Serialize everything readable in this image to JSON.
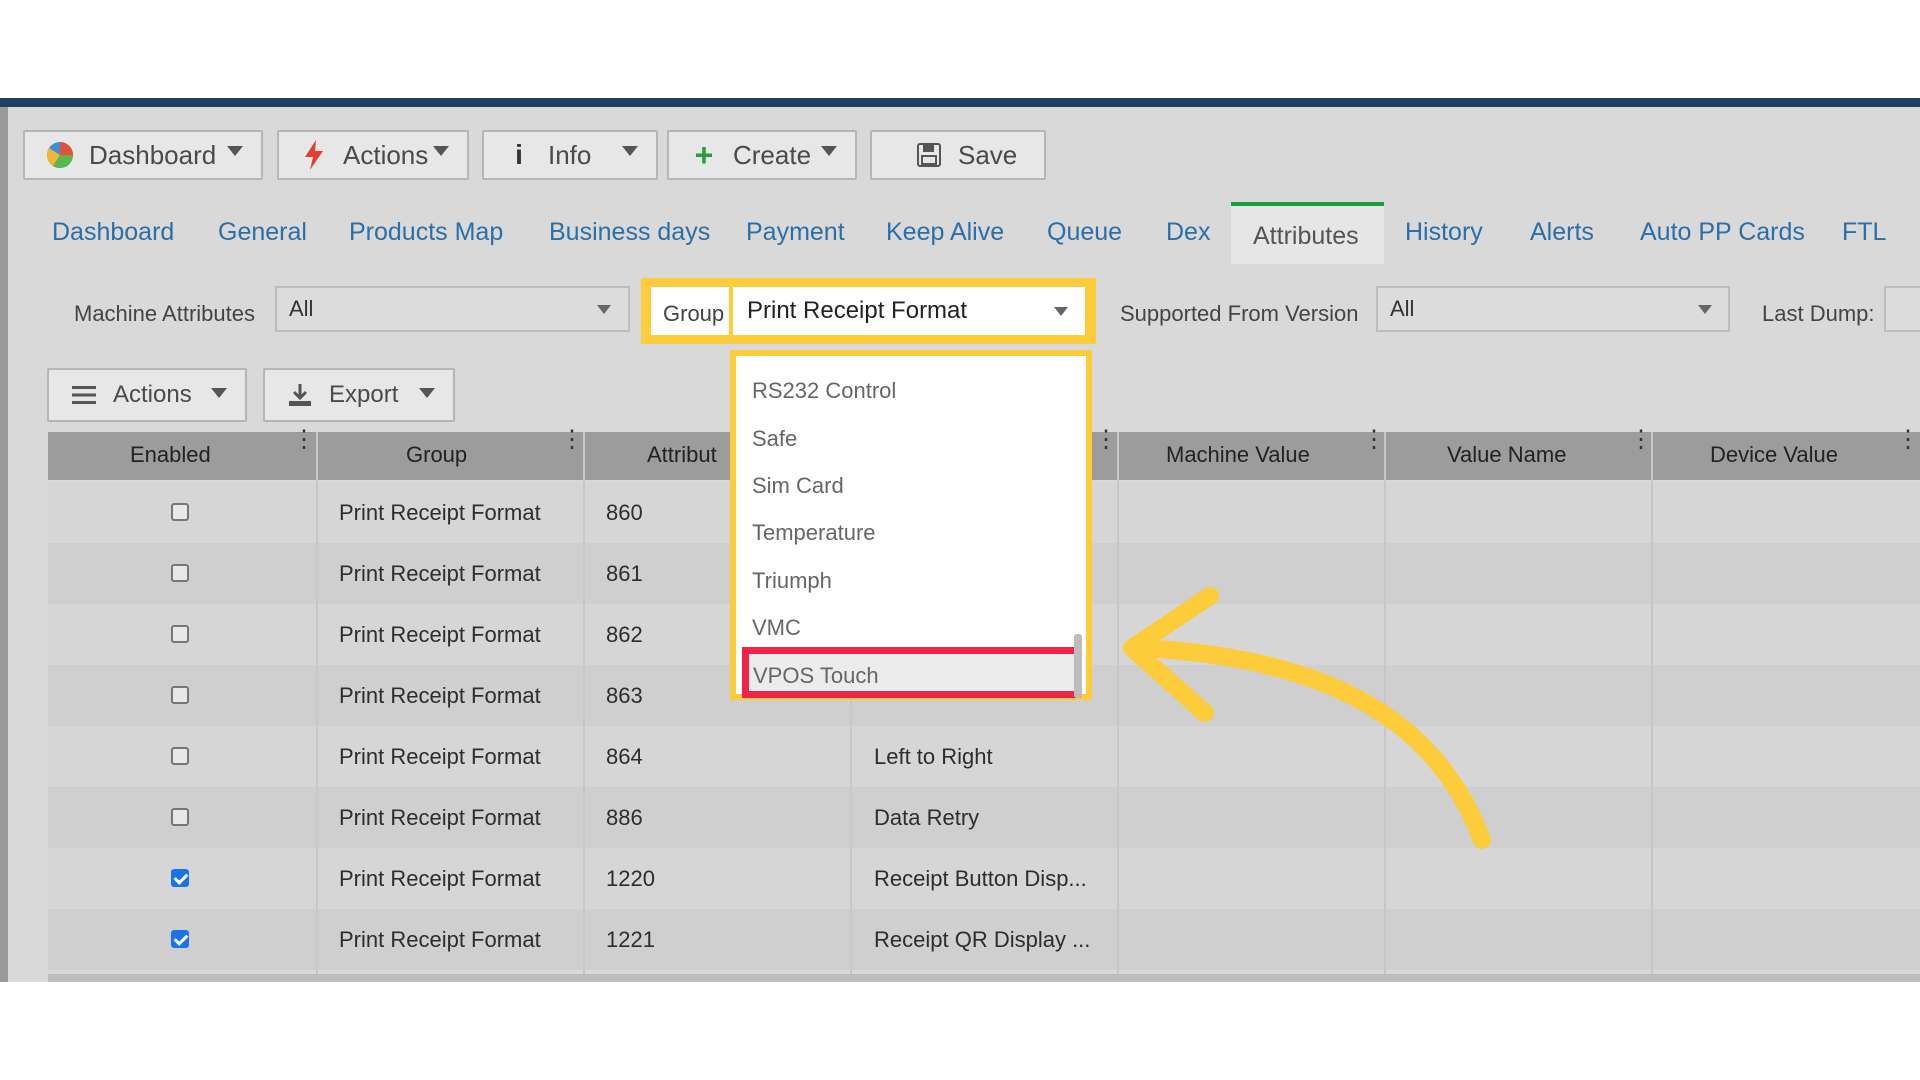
{
  "toolbar": {
    "dashboard": "Dashboard",
    "actions": "Actions",
    "info": "Info",
    "create": "Create",
    "save": "Save"
  },
  "tabs": [
    "Dashboard",
    "General",
    "Products Map",
    "Business days",
    "Payment",
    "Keep Alive",
    "Queue",
    "Dex",
    "Attributes",
    "History",
    "Alerts",
    "Auto PP Cards",
    "FTL"
  ],
  "active_tab": "Attributes",
  "filters": {
    "machine_attributes_label": "Machine Attributes",
    "machine_attributes_value": "All",
    "group_label": "Group",
    "group_value": "Print Receipt Format",
    "supported_label": "Supported From Version",
    "supported_value": "All",
    "last_dump_label": "Last Dump:"
  },
  "grid_toolbar": {
    "actions": "Actions",
    "export": "Export"
  },
  "columns": [
    "Enabled",
    "Group",
    "Attribut",
    "Machine Value",
    "Value Name",
    "Device Value"
  ],
  "rows": [
    {
      "enabled": false,
      "group": "Print Receipt Format",
      "attr": "860",
      "name": ""
    },
    {
      "enabled": false,
      "group": "Print Receipt Format",
      "attr": "861",
      "name": ""
    },
    {
      "enabled": false,
      "group": "Print Receipt Format",
      "attr": "862",
      "name": ""
    },
    {
      "enabled": false,
      "group": "Print Receipt Format",
      "attr": "863",
      "name": ""
    },
    {
      "enabled": false,
      "group": "Print Receipt Format",
      "attr": "864",
      "name": "Left to Right"
    },
    {
      "enabled": false,
      "group": "Print Receipt Format",
      "attr": "886",
      "name": "Data Retry"
    },
    {
      "enabled": true,
      "group": "Print Receipt Format",
      "attr": "1220",
      "name": "Receipt Button Disp..."
    },
    {
      "enabled": true,
      "group": "Print Receipt Format",
      "attr": "1221",
      "name": "Receipt QR Display ..."
    }
  ],
  "dropdown": {
    "options": [
      "RS232 Control",
      "Safe",
      "Sim Card",
      "Temperature",
      "Triumph",
      "VMC",
      "VPOS Touch"
    ],
    "highlighted": "VPOS Touch"
  },
  "colors": {
    "callout_yellow": "#fccc3b",
    "highlight_red": "#f0234a",
    "tab_link": "#2a6fa8",
    "active_tab_bar": "#1a9e3a",
    "checkbox_checked": "#1a73e8"
  }
}
